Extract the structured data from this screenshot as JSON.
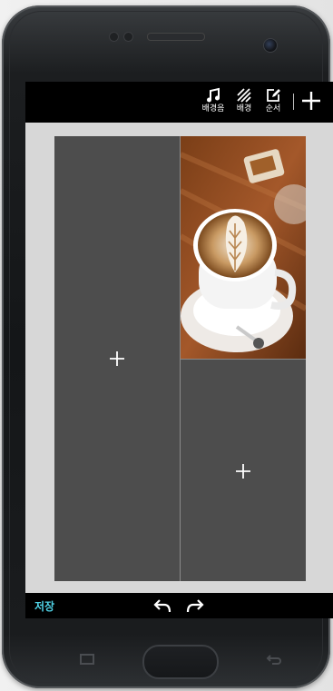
{
  "toolbar": {
    "music_label": "배경음",
    "background_label": "배경",
    "order_label": "순서"
  },
  "icons": {
    "music": "music-note-icon",
    "background": "diagonal-lines-icon",
    "order": "edit-icon",
    "add": "plus-icon",
    "undo": "undo-arrow-icon",
    "redo": "redo-arrow-icon",
    "recent_apps": "recent-apps-icon",
    "back": "back-icon"
  },
  "bottom": {
    "save_label": "저장"
  },
  "colors": {
    "accent": "#4fd2e6",
    "panel": "#4d4d4d",
    "screen_bg": "#d7d7d7"
  }
}
